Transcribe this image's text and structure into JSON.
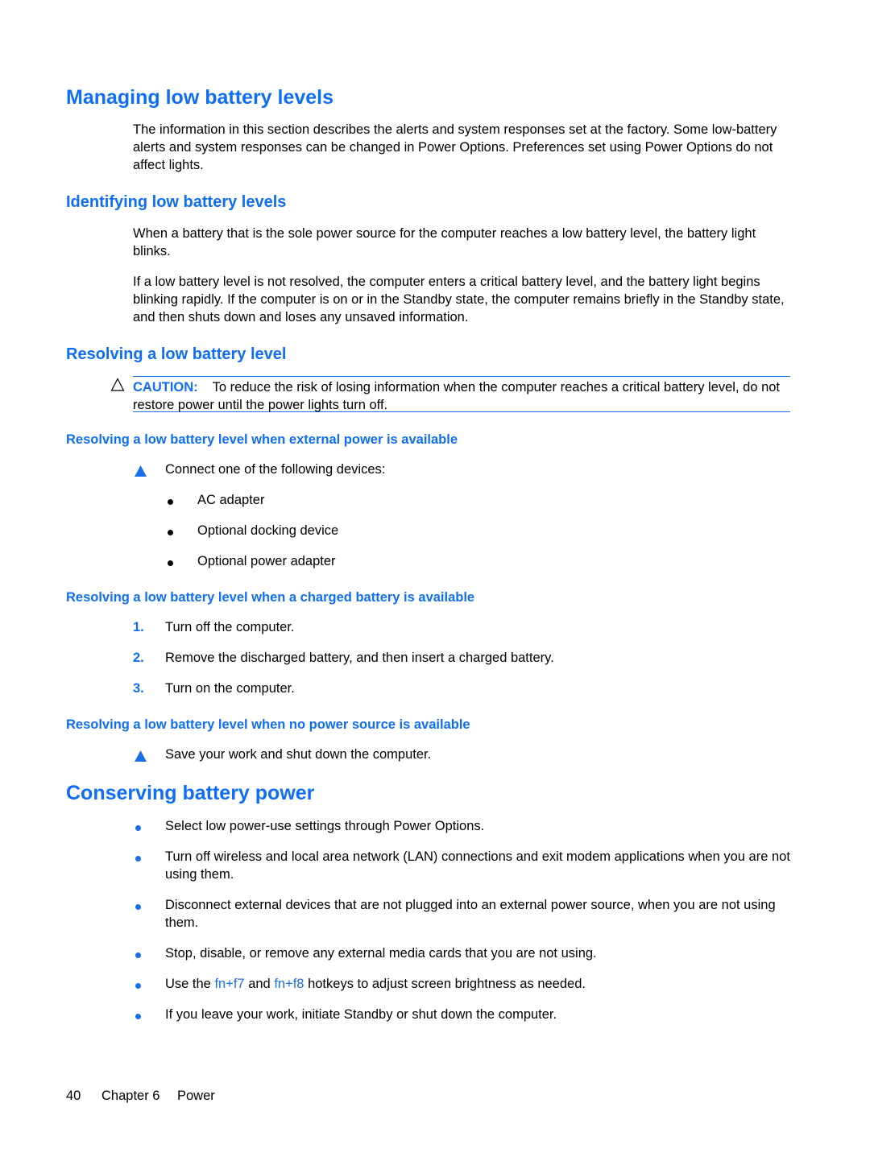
{
  "managing": {
    "title": "Managing low battery levels",
    "intro": "The information in this section describes the alerts and system responses set at the factory. Some low-battery alerts and system responses can be changed in Power Options. Preferences set using Power Options do not affect lights."
  },
  "identifying": {
    "title": "Identifying low battery levels",
    "paragraphs": [
      "When a battery that is the sole power source for the computer reaches a low battery level, the battery light blinks.",
      "If a low battery level is not resolved, the computer enters a critical battery level, and the battery light begins blinking rapidly. If the computer is on or in the Standby state, the computer remains briefly in the Standby state, and then shuts down and loses any unsaved information."
    ]
  },
  "resolving": {
    "title": "Resolving a low battery level",
    "caution": {
      "icon": "caution-triangle-outline-icon",
      "label": "CAUTION:",
      "text": "To reduce the risk of losing information when the computer reaches a critical battery level, do not restore power until the power lights turn off."
    },
    "external": {
      "title": "Resolving a low battery level when external power is available",
      "step_icon": "step-triangle-icon",
      "step": "Connect one of the following devices:",
      "devices": [
        "AC adapter",
        "Optional docking device",
        "Optional power adapter"
      ]
    },
    "charged": {
      "title": "Resolving a low battery level when a charged battery is available",
      "steps": [
        {
          "num": "1.",
          "text": "Turn off the computer."
        },
        {
          "num": "2.",
          "text": "Remove the discharged battery, and then insert a charged battery."
        },
        {
          "num": "3.",
          "text": "Turn on the computer."
        }
      ]
    },
    "no_power": {
      "title": "Resolving a low battery level when no power source is available",
      "step_icon": "step-triangle-icon",
      "step": "Save your work and shut down the computer."
    }
  },
  "conserving": {
    "title": "Conserving battery power",
    "items": [
      "Select low power-use settings through Power Options.",
      "Turn off wireless and local area network (LAN) connections and exit modem applications when you are not using them.",
      "Disconnect external devices that are not plugged into an external power source, when you are not using them.",
      "Stop, disable, or remove any external media cards that you are not using.",
      {
        "pre": "Use the ",
        "key1": "fn+f7",
        "mid": " and ",
        "key2": "fn+f8",
        "post": " hotkeys to adjust screen brightness as needed."
      },
      "If you leave your work, initiate Standby or shut down the computer."
    ]
  },
  "footer": {
    "page_number": "40",
    "chapter": "Chapter 6",
    "chapter_title": "Power"
  }
}
